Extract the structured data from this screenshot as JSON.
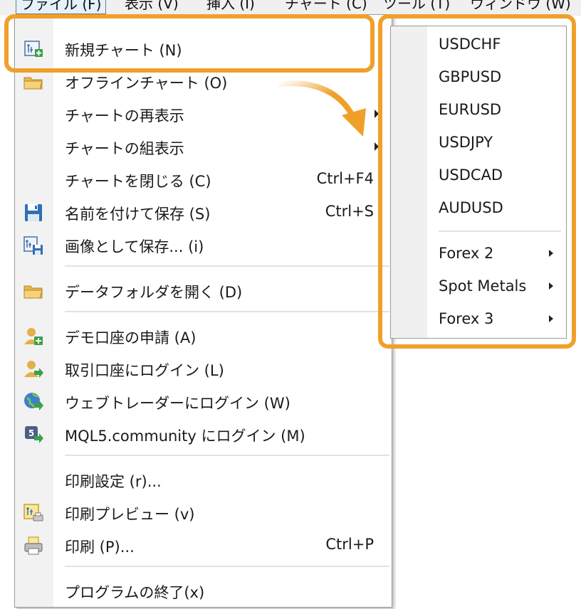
{
  "menubar": {
    "items": [
      {
        "label": "ファイル (F)"
      },
      {
        "label": "表示 (V)"
      },
      {
        "label": "挿入 (I)"
      },
      {
        "label": "チャート (C)"
      },
      {
        "label": "ツール (T)"
      },
      {
        "label": "ウィンドウ (W)"
      }
    ]
  },
  "file_menu": {
    "new_chart": {
      "label": "新規チャート (N)",
      "icon": "new-chart-icon"
    },
    "offline_chart": {
      "label": "オフラインチャート (O)",
      "icon": "folder-icon"
    },
    "reopen_chart": {
      "label": "チャートの再表示"
    },
    "chart_sets": {
      "label": "チャートの組表示"
    },
    "close_chart": {
      "label": "チャートを閉じる (C)",
      "shortcut": "Ctrl+F4"
    },
    "save_as": {
      "label": "名前を付けて保存 (S)",
      "shortcut": "Ctrl+S",
      "icon": "save-icon"
    },
    "save_image": {
      "label": "画像として保存... (i)",
      "icon": "save-image-icon"
    },
    "open_data_folder": {
      "label": "データフォルダを開く (D)",
      "icon": "folder-icon"
    },
    "demo_account": {
      "label": "デモ口座の申請 (A)",
      "icon": "add-user-icon"
    },
    "login_trade": {
      "label": "取引口座にログイン (L)",
      "icon": "user-login-icon"
    },
    "login_web": {
      "label": "ウェブトレーダーにログイン (W)",
      "icon": "globe-login-icon"
    },
    "login_mql5": {
      "label": "MQL5.community にログイン (M)",
      "icon": "mql5-login-icon"
    },
    "print_setup": {
      "label": "印刷設定 (r)..."
    },
    "print_preview": {
      "label": "印刷プレビュー (v)",
      "icon": "print-preview-icon"
    },
    "print": {
      "label": "印刷 (P)...",
      "shortcut": "Ctrl+P",
      "icon": "printer-icon"
    },
    "exit": {
      "label": "プログラムの終了(x)"
    }
  },
  "new_chart_submenu": {
    "symbols": [
      "USDCHF",
      "GBPUSD",
      "EURUSD",
      "USDJPY",
      "USDCAD",
      "AUDUSD"
    ],
    "groups": [
      "Forex 2",
      "Spot Metals",
      "Forex 3"
    ]
  },
  "colors": {
    "highlight": "#f0a02a",
    "menu_background": "#ffffff",
    "gutter_background": "#f2f2f2"
  }
}
